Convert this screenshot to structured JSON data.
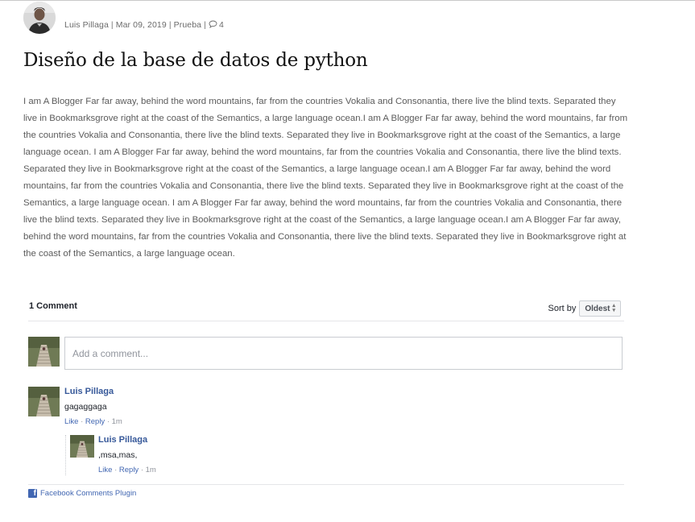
{
  "post": {
    "author": "Luis Pillaga",
    "date": "Mar 09, 2019",
    "category": "Prueba",
    "comment_count": "4",
    "separator": "|",
    "title": "Diseño de la base de datos de python",
    "body": "I am A Blogger Far far away, behind the word mountains, far from the countries Vokalia and Consonantia, there live the blind texts. Separated they live in Bookmarksgrove right at the coast of the Semantics, a large language ocean.I am A Blogger Far far away, behind the word mountains, far from the countries Vokalia and Consonantia, there live the blind texts. Separated they live in Bookmarksgrove right at the coast of the Semantics, a large language ocean. I am A Blogger Far far away, behind the word mountains, far from the countries Vokalia and Consonantia, there live the blind texts. Separated they live in Bookmarksgrove right at the coast of the Semantics, a large language ocean.I am A Blogger Far far away, behind the word mountains, far from the countries Vokalia and Consonantia, there live the blind texts. Separated they live in Bookmarksgrove right at the coast of the Semantics, a large language ocean. I am A Blogger Far far away, behind the word mountains, far from the countries Vokalia and Consonantia, there live the blind texts. Separated they live in Bookmarksgrove right at the coast of the Semantics, a large language ocean.I am A Blogger Far far away, behind the word mountains, far from the countries Vokalia and Consonantia, there live the blind texts. Separated they live in Bookmarksgrove right at the coast of the Semantics, a large language ocean."
  },
  "fb_comments": {
    "count_label": "1 Comment",
    "sort_label": "Sort by",
    "sort_value": "Oldest",
    "input_placeholder": "Add a comment...",
    "comments": [
      {
        "author": "Luis Pillaga",
        "text": "gagaggaga",
        "like": "Like",
        "reply": "Reply",
        "time": "1m"
      },
      {
        "author": "Luis Pillaga",
        "text": ",msa,mas,",
        "like": "Like",
        "reply": "Reply",
        "time": "1m"
      }
    ],
    "action_sep": "·",
    "footer_label": "Facebook Comments Plugin"
  },
  "icons": {
    "comment": "speech-bubble-icon",
    "sort": "updown-arrows-icon",
    "facebook": "facebook-logo-icon"
  },
  "colors": {
    "link_blue": "#365899",
    "fb_blue": "#4267b2",
    "meta_gray": "#6b6b6b",
    "body_gray": "#5b5b5b"
  }
}
